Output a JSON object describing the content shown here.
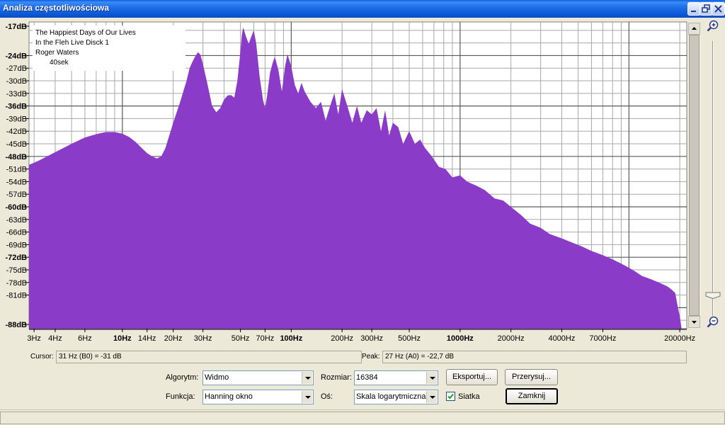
{
  "window": {
    "title": "Analiza częstotliwościowa"
  },
  "annotation": {
    "line1": "The Happiest Days of Our Lives",
    "line2": "In the Fleh Live Disck 1",
    "line3": "Roger Waters",
    "duration": "40sek"
  },
  "chart_data": {
    "type": "area",
    "title": "",
    "xlabel": "",
    "ylabel": "",
    "x_scale": "log",
    "xlim": [
      2.8,
      22000
    ],
    "ylim": [
      -89,
      -16
    ],
    "grid": true,
    "color": "#8A3BC7",
    "y_ticks": [
      {
        "value": -17,
        "label": "-17dB",
        "bold": true
      },
      {
        "value": -24,
        "label": "-24dB",
        "bold": true
      },
      {
        "value": -27,
        "label": "-27dB",
        "bold": false
      },
      {
        "value": -30,
        "label": "-30dB",
        "bold": false
      },
      {
        "value": -33,
        "label": "-33dB",
        "bold": false
      },
      {
        "value": -36,
        "label": "-36dB",
        "bold": true
      },
      {
        "value": -39,
        "label": "-39dB",
        "bold": false
      },
      {
        "value": -42,
        "label": "-42dB",
        "bold": false
      },
      {
        "value": -45,
        "label": "-45dB",
        "bold": false
      },
      {
        "value": -48,
        "label": "-48dB",
        "bold": true
      },
      {
        "value": -51,
        "label": "-51dB",
        "bold": false
      },
      {
        "value": -54,
        "label": "-54dB",
        "bold": false
      },
      {
        "value": -57,
        "label": "-57dB",
        "bold": false
      },
      {
        "value": -60,
        "label": "-60dB",
        "bold": true
      },
      {
        "value": -63,
        "label": "-63dB",
        "bold": false
      },
      {
        "value": -66,
        "label": "-66dB",
        "bold": false
      },
      {
        "value": -69,
        "label": "-69dB",
        "bold": false
      },
      {
        "value": -72,
        "label": "-72dB",
        "bold": true
      },
      {
        "value": -75,
        "label": "-75dB",
        "bold": false
      },
      {
        "value": -78,
        "label": "-78dB",
        "bold": false
      },
      {
        "value": -81,
        "label": "-81dB",
        "bold": false
      },
      {
        "value": -88,
        "label": "-88dB",
        "bold": true
      }
    ],
    "x_ticks": [
      {
        "value": 3,
        "label": "3Hz",
        "bold": false
      },
      {
        "value": 4,
        "label": "4Hz",
        "bold": false
      },
      {
        "value": 6,
        "label": "6Hz",
        "bold": false
      },
      {
        "value": 10,
        "label": "10Hz",
        "bold": true
      },
      {
        "value": 14,
        "label": "14Hz",
        "bold": false
      },
      {
        "value": 20,
        "label": "20Hz",
        "bold": false
      },
      {
        "value": 30,
        "label": "30Hz",
        "bold": false
      },
      {
        "value": 50,
        "label": "50Hz",
        "bold": false
      },
      {
        "value": 70,
        "label": "70Hz",
        "bold": false
      },
      {
        "value": 100,
        "label": "100Hz",
        "bold": true
      },
      {
        "value": 200,
        "label": "200Hz",
        "bold": false
      },
      {
        "value": 300,
        "label": "300Hz",
        "bold": false
      },
      {
        "value": 500,
        "label": "500Hz",
        "bold": false
      },
      {
        "value": 1000,
        "label": "1000Hz",
        "bold": true
      },
      {
        "value": 2000,
        "label": "2000Hz",
        "bold": false
      },
      {
        "value": 4000,
        "label": "4000Hz",
        "bold": false
      },
      {
        "value": 7000,
        "label": "7000Hz",
        "bold": false
      },
      {
        "value": 20000,
        "label": "20000Hz",
        "bold": false
      }
    ],
    "series": [
      {
        "x": [
          2.8,
          3.2,
          4,
          5,
          6,
          7,
          8,
          9,
          10,
          11,
          12,
          13,
          14,
          15,
          16,
          17,
          18,
          20,
          22,
          24,
          25,
          26,
          27,
          28,
          29,
          30,
          32,
          34,
          36,
          38,
          40,
          42,
          44,
          46,
          48,
          50,
          51,
          52,
          54,
          56,
          58,
          60,
          62,
          65,
          68,
          70,
          72,
          75,
          78,
          80,
          84,
          88,
          92,
          95,
          100,
          105,
          110,
          115,
          120,
          130,
          140,
          150,
          160,
          170,
          180,
          190,
          200,
          215,
          230,
          245,
          260,
          280,
          300,
          320,
          340,
          360,
          380,
          400,
          430,
          460,
          500,
          540,
          580,
          620,
          680,
          750,
          820,
          900,
          1000,
          1100,
          1250,
          1400,
          1600,
          1800,
          2000,
          2300,
          2600,
          3000,
          3400,
          4000,
          4600,
          5300,
          6000,
          7000,
          8000,
          9000,
          10000,
          11000,
          12000,
          13000,
          14000,
          15000,
          16000,
          17000,
          18000,
          18800,
          19500,
          20000,
          20500,
          21000
        ],
        "y": [
          -50,
          -49,
          -47,
          -45,
          -43.5,
          -42.7,
          -42.2,
          -42.2,
          -42.6,
          -43.4,
          -44.6,
          -46,
          -47.2,
          -48,
          -48.5,
          -48,
          -46,
          -40,
          -35,
          -30,
          -27,
          -25.5,
          -24.2,
          -23.2,
          -23.8,
          -26,
          -31,
          -36,
          -37.5,
          -36.5,
          -34.5,
          -33.5,
          -33.4,
          -34,
          -30,
          -23,
          -19,
          -17.3,
          -19.5,
          -21.2,
          -19.5,
          -18,
          -21,
          -29,
          -34.5,
          -36.5,
          -33.5,
          -28,
          -25.5,
          -24.3,
          -27.5,
          -32.5,
          -26.5,
          -23.7,
          -26.5,
          -31,
          -33,
          -30.5,
          -32.5,
          -35,
          -36.5,
          -35,
          -39.5,
          -36,
          -33,
          -38,
          -32,
          -36,
          -40,
          -36,
          -40,
          -37,
          -38,
          -36.5,
          -42,
          -37,
          -43,
          -40,
          -41,
          -45,
          -42,
          -45,
          -44,
          -46,
          -48,
          -50.5,
          -51,
          -53,
          -52.5,
          -54,
          -55,
          -56,
          -58,
          -58.5,
          -60,
          -62,
          -64,
          -65,
          -66.5,
          -67.5,
          -68.5,
          -69.5,
          -70.5,
          -71.5,
          -72.5,
          -73.5,
          -74.5,
          -75.5,
          -76.5,
          -77,
          -77.5,
          -78,
          -78.5,
          -79,
          -79.8,
          -80.5,
          -84,
          -86,
          -89,
          -89
        ]
      }
    ]
  },
  "status": {
    "cursor_label": "Cursor:",
    "cursor_value": "31 Hz (B0) = -31 dB",
    "peak_label": "Peak:",
    "peak_value": "27 Hz (A0) = -22,7 dB"
  },
  "controls": {
    "algorithm_label": "Algorytm:",
    "algorithm_value": "Widmo",
    "size_label": "Rozmiar:",
    "size_value": "16384",
    "export_label": "Eksportuj...",
    "replot_label": "Przerysuj...",
    "function_label": "Funkcja:",
    "function_value": "Hanning okno",
    "axis_label": "Oś:",
    "axis_value": "Skala logarytmiczna",
    "grid_label": "Siatka",
    "grid_checked": true,
    "close_label": "Zamknij"
  }
}
